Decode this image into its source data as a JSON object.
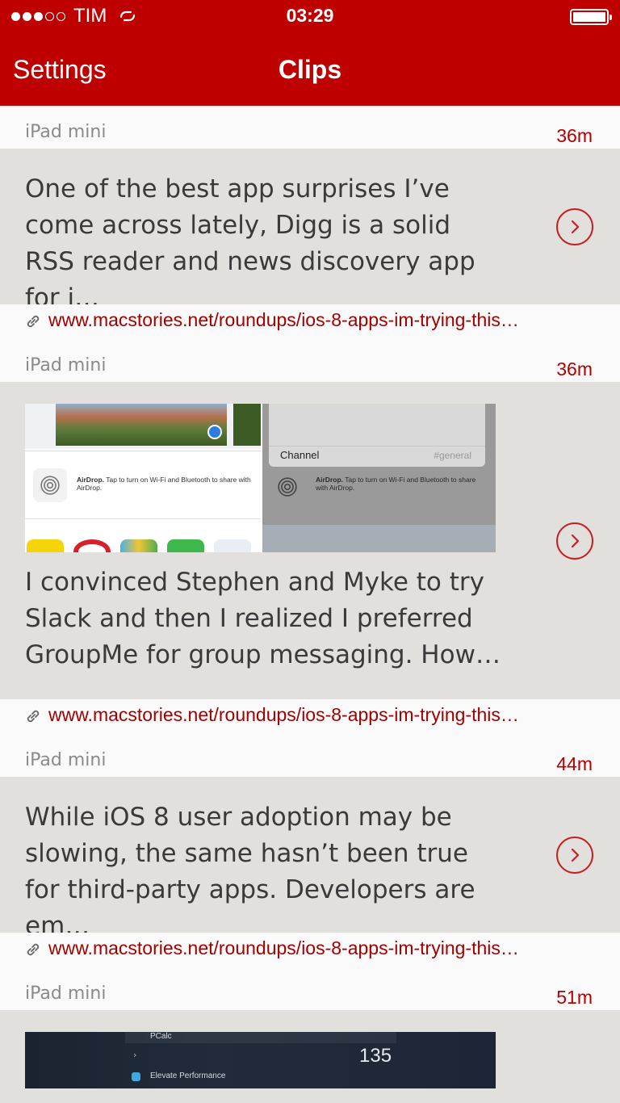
{
  "status": {
    "carrier": "TIM",
    "time": "03:29"
  },
  "nav": {
    "left": "Settings",
    "title": "Clips"
  },
  "clips": [
    {
      "device": "iPad mini",
      "age": "36m",
      "text": "One of the best app surprises I’ve come across lately, Digg is a solid RSS reader and news discovery app for i…",
      "url": "www.macstories.net/roundups/ios-8-apps-im-trying-this…"
    },
    {
      "device": "iPad mini",
      "age": "36m",
      "text": "I convinced Stephen and Myke to try Slack and then I realized I preferred GroupMe for group messaging. How…",
      "url": "www.macstories.net/roundups/ios-8-apps-im-trying-this…",
      "thumb": {
        "airdrop_title": "AirDrop.",
        "airdrop_text": "Tap to turn on Wi-Fi and Bluetooth to share with AirDrop.",
        "channel_label": "Channel",
        "channel_value": "#general"
      }
    },
    {
      "device": "iPad mini",
      "age": "44m",
      "text": "While iOS 8 user adoption may be slowing, the same hasn’t been true for third-party apps. Developers are em…",
      "url": "www.macstories.net/roundups/ios-8-apps-im-trying-this…"
    },
    {
      "device": "iPad mini",
      "age": "51m",
      "thumb": {
        "row1": "PCalc",
        "value": "135",
        "row2": "Elevate Performance"
      }
    }
  ],
  "colors": {
    "accent": "#bf0000",
    "card": "#e1e0dc",
    "link": "#a30000"
  },
  "icons": {
    "open": "chevron-right-circle-icon",
    "link": "link-icon",
    "sync": "link-sync-icon"
  }
}
